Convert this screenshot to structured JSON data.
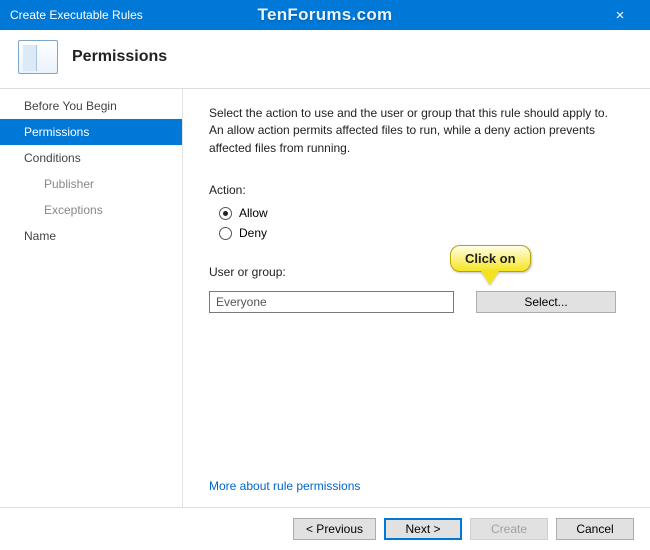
{
  "window": {
    "title": "Create Executable Rules",
    "watermark": "TenForums.com"
  },
  "header": {
    "page_title": "Permissions"
  },
  "sidebar": {
    "items": [
      {
        "label": "Before You Begin",
        "level": "top",
        "selected": false
      },
      {
        "label": "Permissions",
        "level": "top",
        "selected": true
      },
      {
        "label": "Conditions",
        "level": "top",
        "selected": false
      },
      {
        "label": "Publisher",
        "level": "sub",
        "selected": false
      },
      {
        "label": "Exceptions",
        "level": "sub",
        "selected": false
      },
      {
        "label": "Name",
        "level": "top",
        "selected": false
      }
    ]
  },
  "main": {
    "description": "Select the action to use and the user or group that this rule should apply to. An allow action permits affected files to run, while a deny action prevents affected files from running.",
    "action": {
      "label": "Action:",
      "options": [
        {
          "label": "Allow",
          "checked": true
        },
        {
          "label": "Deny",
          "checked": false
        }
      ]
    },
    "user_group": {
      "label": "User or group:",
      "value": "Everyone",
      "select_button": "Select..."
    },
    "link": "More about rule permissions"
  },
  "callout": {
    "text": "Click on"
  },
  "footer": {
    "previous": "< Previous",
    "next": "Next >",
    "create": "Create",
    "cancel": "Cancel"
  }
}
